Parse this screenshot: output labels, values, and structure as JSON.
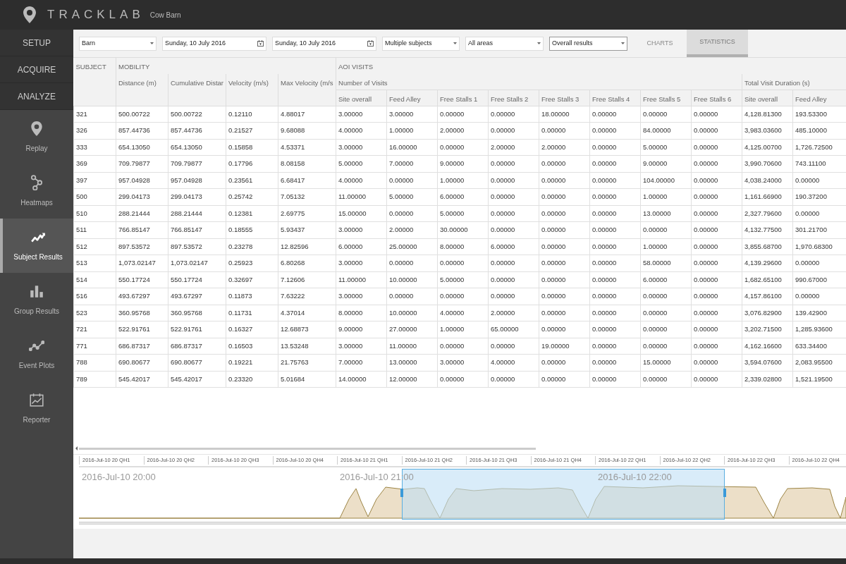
{
  "app": {
    "name": "TRACKLAB",
    "project": "Cow Barn"
  },
  "sections": [
    "SETUP",
    "ACQUIRE",
    "ANALYZE"
  ],
  "nav": [
    {
      "label": "Replay",
      "selected": false
    },
    {
      "label": "Heatmaps",
      "selected": false
    },
    {
      "label": "Subject Results",
      "selected": true
    },
    {
      "label": "Group Results",
      "selected": false
    },
    {
      "label": "Event Plots",
      "selected": false
    },
    {
      "label": "Reporter",
      "selected": false
    }
  ],
  "toolbar": [
    {
      "kind": "dropdown",
      "value": "Barn"
    },
    {
      "kind": "date",
      "value": "Sunday, 10 July 2016"
    },
    {
      "kind": "date",
      "value": "Sunday, 10 July 2016"
    },
    {
      "kind": "dropdown",
      "value": "Multiple subjects"
    },
    {
      "kind": "dropdown",
      "value": "All areas"
    },
    {
      "kind": "dropdown",
      "value": "Overall results"
    }
  ],
  "tabs": [
    {
      "label": "CHARTS",
      "selected": false
    },
    {
      "label": "STATISTICS",
      "selected": true
    }
  ],
  "table": {
    "groups": [
      "SUBJECT",
      "MOBILITY",
      "AOI VISITS"
    ],
    "mobility_columns": [
      "Distance (m)",
      "Cumulative Distar",
      "Velocity (m/s)",
      "Max Velocity (m/s"
    ],
    "aoi_groups": [
      "Number of Visits",
      "Total Visit Duration (s)"
    ],
    "aoi_columns": [
      "Site overall",
      "Feed Alley",
      "Free Stalls 1",
      "Free Stalls 2",
      "Free Stalls 3",
      "Free Stalls 4",
      "Free Stalls 5",
      "Free Stalls 6",
      "Site overall",
      "Feed Alley"
    ],
    "rows": [
      [
        "321",
        "500.00722",
        "500.00722",
        "0.12110",
        "4.88017",
        "3.00000",
        "3.00000",
        "0.00000",
        "0.00000",
        "18.00000",
        "0.00000",
        "0.00000",
        "0.00000",
        "4,128.81300",
        "193.53300"
      ],
      [
        "326",
        "857.44736",
        "857.44736",
        "0.21527",
        "9.68088",
        "4.00000",
        "1.00000",
        "2.00000",
        "0.00000",
        "0.00000",
        "0.00000",
        "84.00000",
        "0.00000",
        "3,983.03600",
        "485.10000"
      ],
      [
        "333",
        "654.13050",
        "654.13050",
        "0.15858",
        "4.53371",
        "3.00000",
        "16.00000",
        "0.00000",
        "2.00000",
        "2.00000",
        "0.00000",
        "5.00000",
        "0.00000",
        "4,125.00700",
        "1,726.72500"
      ],
      [
        "369",
        "709.79877",
        "709.79877",
        "0.17796",
        "8.08158",
        "5.00000",
        "7.00000",
        "9.00000",
        "0.00000",
        "0.00000",
        "0.00000",
        "9.00000",
        "0.00000",
        "3,990.70600",
        "743.11100"
      ],
      [
        "397",
        "957.04928",
        "957.04928",
        "0.23561",
        "6.68417",
        "4.00000",
        "0.00000",
        "1.00000",
        "0.00000",
        "0.00000",
        "0.00000",
        "104.00000",
        "0.00000",
        "4,038.24000",
        "0.00000"
      ],
      [
        "500",
        "299.04173",
        "299.04173",
        "0.25742",
        "7.05132",
        "11.00000",
        "5.00000",
        "6.00000",
        "0.00000",
        "0.00000",
        "0.00000",
        "1.00000",
        "0.00000",
        "1,161.66900",
        "190.37200"
      ],
      [
        "510",
        "288.21444",
        "288.21444",
        "0.12381",
        "2.69775",
        "15.00000",
        "0.00000",
        "5.00000",
        "0.00000",
        "0.00000",
        "0.00000",
        "13.00000",
        "0.00000",
        "2,327.79600",
        "0.00000"
      ],
      [
        "511",
        "766.85147",
        "766.85147",
        "0.18555",
        "5.93437",
        "3.00000",
        "2.00000",
        "30.00000",
        "0.00000",
        "0.00000",
        "0.00000",
        "0.00000",
        "0.00000",
        "4,132.77500",
        "301.21700"
      ],
      [
        "512",
        "897.53572",
        "897.53572",
        "0.23278",
        "12.82596",
        "6.00000",
        "25.00000",
        "8.00000",
        "6.00000",
        "0.00000",
        "0.00000",
        "1.00000",
        "0.00000",
        "3,855.68700",
        "1,970.68300"
      ],
      [
        "513",
        "1,073.02147",
        "1,073.02147",
        "0.25923",
        "6.80268",
        "3.00000",
        "0.00000",
        "0.00000",
        "0.00000",
        "0.00000",
        "0.00000",
        "58.00000",
        "0.00000",
        "4,139.29600",
        "0.00000"
      ],
      [
        "514",
        "550.17724",
        "550.17724",
        "0.32697",
        "7.12606",
        "11.00000",
        "10.00000",
        "5.00000",
        "0.00000",
        "0.00000",
        "0.00000",
        "6.00000",
        "0.00000",
        "1,682.65100",
        "990.67000"
      ],
      [
        "516",
        "493.67297",
        "493.67297",
        "0.11873",
        "7.63222",
        "3.00000",
        "0.00000",
        "0.00000",
        "0.00000",
        "0.00000",
        "0.00000",
        "0.00000",
        "0.00000",
        "4,157.86100",
        "0.00000"
      ],
      [
        "523",
        "360.95768",
        "360.95768",
        "0.11731",
        "4.37014",
        "8.00000",
        "10.00000",
        "4.00000",
        "2.00000",
        "0.00000",
        "0.00000",
        "0.00000",
        "0.00000",
        "3,076.82900",
        "139.42900"
      ],
      [
        "721",
        "522.91761",
        "522.91761",
        "0.16327",
        "12.68873",
        "9.00000",
        "27.00000",
        "1.00000",
        "65.00000",
        "0.00000",
        "0.00000",
        "0.00000",
        "0.00000",
        "3,202.71500",
        "1,285.93600"
      ],
      [
        "771",
        "686.87317",
        "686.87317",
        "0.16503",
        "13.53248",
        "3.00000",
        "11.00000",
        "0.00000",
        "0.00000",
        "19.00000",
        "0.00000",
        "0.00000",
        "0.00000",
        "4,162.16600",
        "633.34400"
      ],
      [
        "788",
        "690.80677",
        "690.80677",
        "0.19221",
        "21.75763",
        "7.00000",
        "13.00000",
        "3.00000",
        "4.00000",
        "0.00000",
        "0.00000",
        "15.00000",
        "0.00000",
        "3,594.07600",
        "2,083.95500"
      ],
      [
        "789",
        "545.42017",
        "545.42017",
        "0.23320",
        "5.01684",
        "14.00000",
        "12.00000",
        "0.00000",
        "0.00000",
        "0.00000",
        "0.00000",
        "0.00000",
        "0.00000",
        "2,339.02800",
        "1,521.19500"
      ]
    ]
  },
  "timeline": {
    "ticks": [
      "2016-Jul-10 20 QH1",
      "2016-Jul-10 20 QH2",
      "2016-Jul-10 20 QH3",
      "2016-Jul-10 20 QH4",
      "2016-Jul-10 21 QH1",
      "2016-Jul-10 21 QH2",
      "2016-Jul-10 21 QH3",
      "2016-Jul-10 21 QH4",
      "2016-Jul-10 22 QH1",
      "2016-Jul-10 22 QH2",
      "2016-Jul-10 22 QH3",
      "2016-Jul-10 22 QH4"
    ],
    "hours": [
      "2016-Jul-10 20:00",
      "2016-Jul-10 21:00",
      "2016-Jul-10 22:00"
    ]
  }
}
